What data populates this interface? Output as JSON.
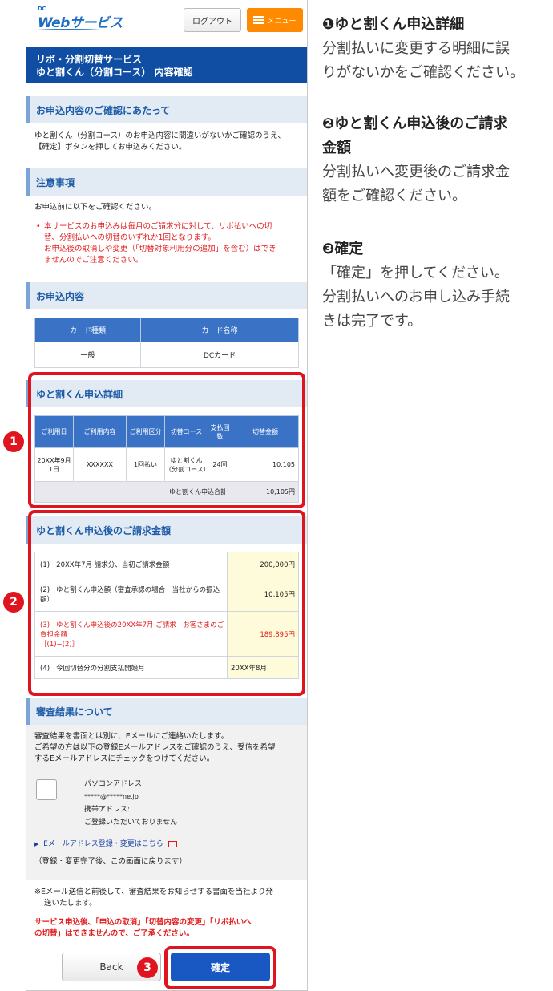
{
  "header": {
    "logo_sup": "DC",
    "logo_text": "Webサービス",
    "logout_label": "ログアウト",
    "menu_label": "メニュー"
  },
  "title": {
    "line1": "リボ・分割切替サービス",
    "line2": "ゆと割くん（分割コース） 内容確認"
  },
  "confirm_notes": {
    "heading": "お申込内容のご確認にあたって",
    "line1": "ゆと割くん（分割コース）のお申込内容に間違いがないかご確認のうえ、",
    "line2": "【確定】ボタンを押してお申込みください。"
  },
  "caution": {
    "heading": "注意事項",
    "intro": "お申込前に以下をご確認ください。",
    "line1": "本サービスのお申込みは毎月のご請求分に対して、リボ払いへの切",
    "line2": "替、分割払いへの切替のいずれか1回となります。",
    "line3": "お申込後の取消しや変更（「切替対象利用分の追加」を含む）はでき",
    "line4": "ませんのでご注意ください。"
  },
  "application": {
    "heading": "お申込内容",
    "col_card_type": "カード種類",
    "col_card_name": "カード名称",
    "card_type": "一般",
    "card_name": "DCカード"
  },
  "detail": {
    "heading": "ゆと割くん申込詳細",
    "headers": [
      "ご利用日",
      "ご利用内容",
      "ご利用区分",
      "切替コース",
      "支払回数",
      "切替金額"
    ],
    "row": {
      "date": "20XX年9月1日",
      "content": "XXXXXX",
      "category": "1回払い",
      "course": "ゆと割くん（分割コース）",
      "count": "24回",
      "amount": "10,105"
    },
    "total_label": "ゆと割くん申込合計",
    "total_value": "10,105円"
  },
  "billing": {
    "heading": "ゆと割くん申込後のご請求金額",
    "rows": [
      {
        "no": "(1)",
        "label": "20XX年7月 請求分、当初ご請求金額",
        "value": "200,000円"
      },
      {
        "no": "(2)",
        "label": "ゆと割くん申込額（審査承認の場合　当社からの振込額）",
        "value": "10,105円"
      },
      {
        "no": "(3)",
        "label": "ゆと割くん申込後の20XX年7月 ご請求　お客さまのご負担金額",
        "label2": "［(1)−(2)］",
        "value": "189,895円"
      },
      {
        "no": "(4)",
        "label": "今回切替分の分割支払開始月",
        "value": "20XX年8月"
      }
    ]
  },
  "review": {
    "heading": "審査結果について",
    "line1": "審査結果を書面とは別に、Eメールにご連絡いたします。",
    "line2": "ご希望の方は以下の登録Eメールアドレスをご確認のうえ、受信を希望",
    "line3": "するEメールアドレスにチェックをつけてください。",
    "pc_label": "パソコンアドレス:",
    "pc_value": "*****@*****ne.jp",
    "mobile_label": "携帯アドレス:",
    "mobile_value": "ご登録いただいておりません",
    "link_label": "Eメールアドレス登録・変更はこちら",
    "return_note": "（登録・変更完了後、この画面に戻ります）"
  },
  "footer_notes": {
    "note1": "※Eメール送信と前後して、審査結果をお知らせする書面を当社より発",
    "note2": "送いたします。",
    "warn1": "サービス申込後、「申込の取消」「切替内容の変更」「リボ払いへ",
    "warn2": "の切替」はできませんので、ご了承ください。"
  },
  "buttons": {
    "back": "Back",
    "confirm": "確定"
  },
  "badges": [
    "1",
    "2",
    "3"
  ],
  "explanations": [
    {
      "title": "❶ゆと割くん申込詳細",
      "body1": "分割払いに変更する明細に誤",
      "body2": "りがないかをご確認ください。"
    },
    {
      "title": "❷ゆと割くん申込後のご請求",
      "title2": "金額",
      "body1": "分割払いへ変更後のご請求金",
      "body2": "額をご確認ください。"
    },
    {
      "title": "❸確定",
      "body1": "「確定」を押してください。",
      "body2": "分割払いへのお申し込み手続",
      "body3": "きは完了です。"
    }
  ],
  "colors": {
    "primary": "#0f4ea3",
    "table_header": "#3a73c6",
    "highlight": "#e0141e",
    "menu": "#ff8a00",
    "billing_cell": "#fdfbd9"
  }
}
